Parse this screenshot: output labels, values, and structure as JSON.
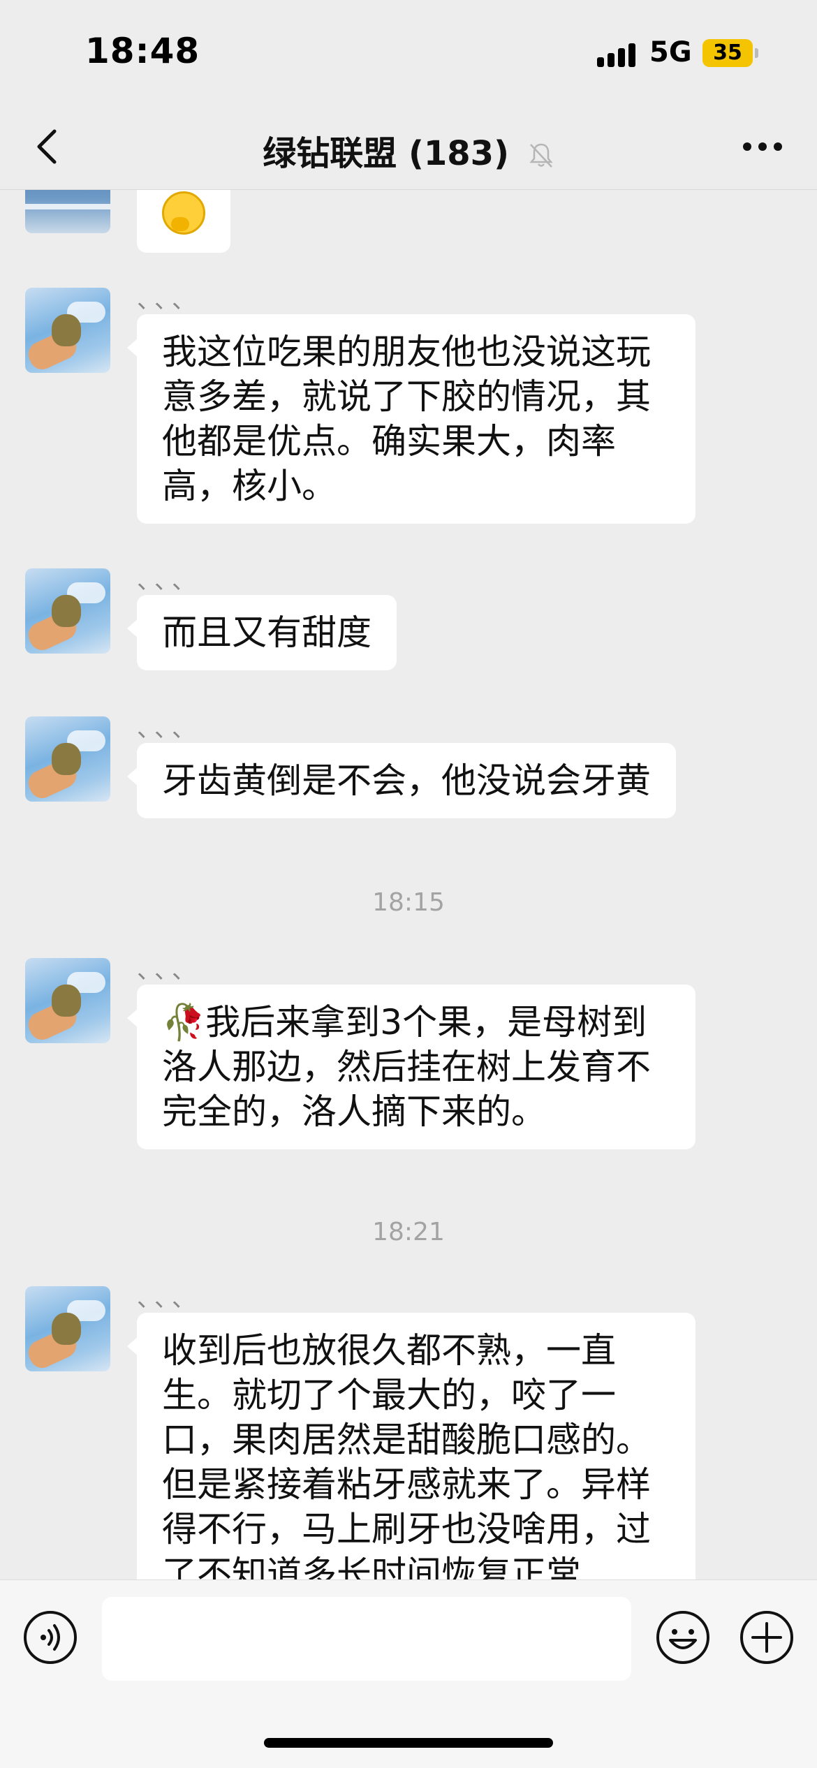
{
  "status_bar": {
    "time": "18:48",
    "network": "5G",
    "battery": "35"
  },
  "nav": {
    "title": "绿钻联盟 (183)",
    "icons": [
      "chevron-left-icon",
      "bell-muted-icon",
      "more-dots-icon"
    ]
  },
  "messages": [
    {
      "sender": "、、、",
      "text": "我这位吃果的朋友他也没说这玩意多差，就说了下胶的情况，其他都是优点。确实果大，肉率高，核小。",
      "lines": [
        "我这位吃果的朋友他也没说这玩",
        "意多差，就说了下胶的情况，其",
        "他都是优点。确实果大，肉率",
        "高，核小。"
      ]
    },
    {
      "sender": "、、、",
      "text": "而且又有甜度",
      "lines": [
        "而且又有甜度"
      ]
    },
    {
      "sender": "、、、",
      "text": "牙齿黄倒是不会，他没说会牙黄",
      "lines": [
        "牙齿黄倒是不会，他没说会牙黄"
      ]
    },
    {
      "sender": "、、、",
      "text": "🥀我后来拿到3个果，是母树到洛人那边，然后挂在树上发育不完全的，洛人摘下来的。",
      "lines": [
        "🥀我后来拿到3个果，是母树到",
        "洛人那边，然后挂在树上发育不",
        "完全的，洛人摘下来的。"
      ]
    },
    {
      "sender": "、、、",
      "text": "收到后也放很久都不熟，一直生。就切了个最大的，咬了一口，果肉居然是甜酸脆口感的。但是紧接着粘牙感就来了。异样得不行，马上刷牙也没啥用，过了不知道多长时间恢复正常",
      "lines": [
        "收到后也放很久都不熟，一直",
        "生。就切了个最大的，咬了一",
        "口，果肉居然是甜酸脆口感的。",
        "但是紧接着粘牙感就来了。异样",
        "得不行，马上刷牙也没啥用，过",
        "了不知道多长时间恢复正常"
      ]
    }
  ],
  "time_dividers": [
    "18:15",
    "18:21"
  ],
  "input_bar": {
    "placeholder": "",
    "icons": [
      "voice-icon",
      "emoji-icon",
      "plus-icon"
    ]
  }
}
